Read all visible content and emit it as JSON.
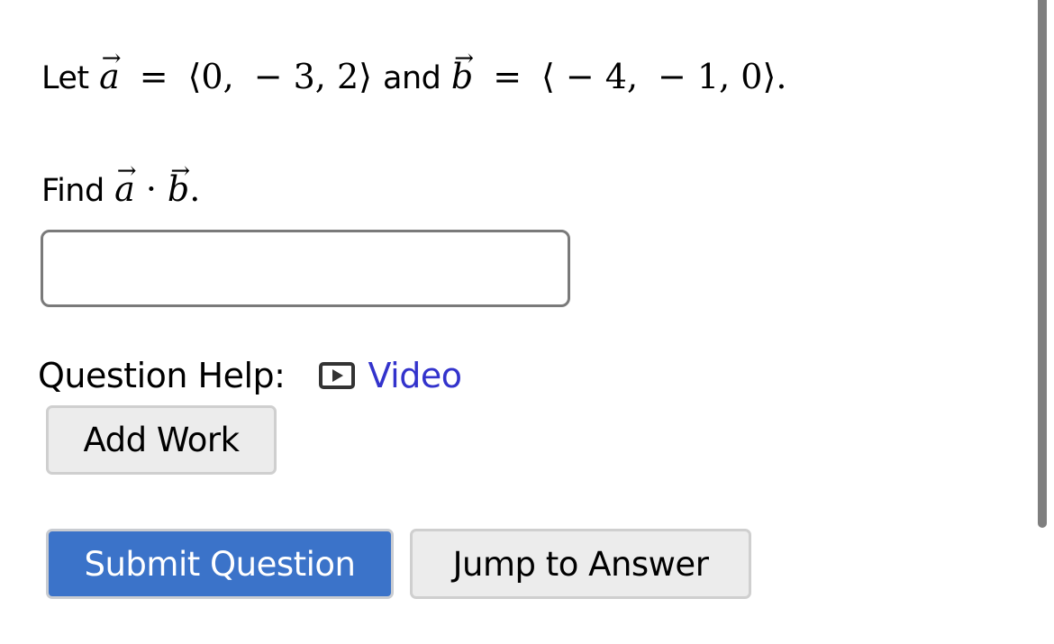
{
  "problem": {
    "line1": {
      "prefix": "Let",
      "vec_a_symbol": "a",
      "equals": "=",
      "vec_a_open": "⟨",
      "vec_a_components": [
        "0,",
        "− 3, 2"
      ],
      "vec_a_close": "⟩",
      "conjunction": "and",
      "vec_b_symbol": "b",
      "vec_b_open": "⟨",
      "vec_b_components": [
        "− 4,",
        "− 1, 0"
      ],
      "vec_b_close": "⟩",
      "period": "."
    },
    "line2": {
      "prefix": "Find",
      "vec_a_symbol": "a",
      "operator": "·",
      "vec_b_symbol": "b",
      "period": "."
    }
  },
  "answer_input": {
    "value": "",
    "placeholder": ""
  },
  "help": {
    "label": "Question Help:",
    "video_icon": "play-icon",
    "video_label": "Video",
    "link_color": "#3333cc"
  },
  "buttons": {
    "add_work": "Add Work",
    "submit": "Submit Question",
    "jump": "Jump to Answer",
    "primary_color": "#3b73c9"
  }
}
